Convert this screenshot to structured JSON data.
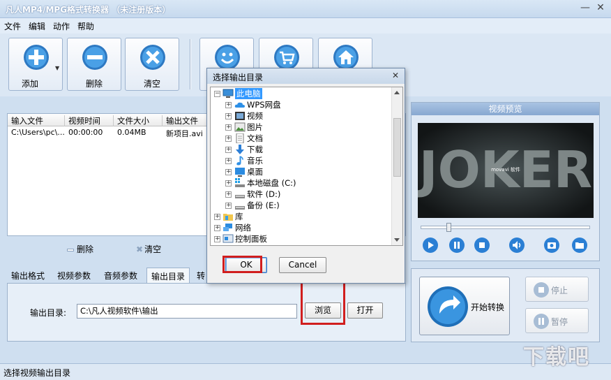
{
  "window": {
    "title": "凡人MP4/MPG格式转换器 （未注册版本）",
    "min": "—",
    "close": "✕"
  },
  "menu": [
    "文件",
    "编辑",
    "动作",
    "帮助"
  ],
  "toolbar": {
    "add": "添加",
    "delete": "删除",
    "clear": "清空"
  },
  "file_list": {
    "columns": [
      "输入文件",
      "视频时间",
      "文件大小",
      "输出文件"
    ],
    "rows": [
      {
        "input": "C:\\Users\\pc\\...",
        "duration": "00:00:00",
        "size": "0.04MB",
        "output": "新项目.avi"
      }
    ]
  },
  "list_ops": {
    "delete": "删除",
    "clear": "清空"
  },
  "tabs": [
    "输出格式",
    "视频参数",
    "音频参数",
    "输出目录",
    "转"
  ],
  "active_tab": "输出目录",
  "output": {
    "label": "输出目录:",
    "path": "C:\\凡人视频软件\\输出",
    "browse": "浏览",
    "open": "打开"
  },
  "preview": {
    "title": "视频预览",
    "video_text": "JOKER",
    "video_caption": "movavi 软件"
  },
  "convert": {
    "start": "开始转换",
    "stop": "停止",
    "pause": "暂停"
  },
  "status": "选择视频输出目录",
  "watermark": "下载吧",
  "dialog": {
    "title": "选择输出目录",
    "close": "✕",
    "tree": [
      {
        "label": "此电脑",
        "selected": true
      },
      {
        "label": "WPS网盘"
      },
      {
        "label": "视频"
      },
      {
        "label": "图片"
      },
      {
        "label": "文档"
      },
      {
        "label": "下载"
      },
      {
        "label": "音乐"
      },
      {
        "label": "桌面"
      },
      {
        "label": "本地磁盘 (C:)"
      },
      {
        "label": "软件 (D:)"
      },
      {
        "label": "备份 (E:)"
      },
      {
        "label": "库"
      },
      {
        "label": "网络"
      },
      {
        "label": "控制面板"
      }
    ],
    "ok": "OK",
    "cancel": "Cancel"
  },
  "colors": {
    "highlight_red": "#d11e1e",
    "selection": "#3399ff",
    "blue_icon": "#2b7fd4"
  }
}
